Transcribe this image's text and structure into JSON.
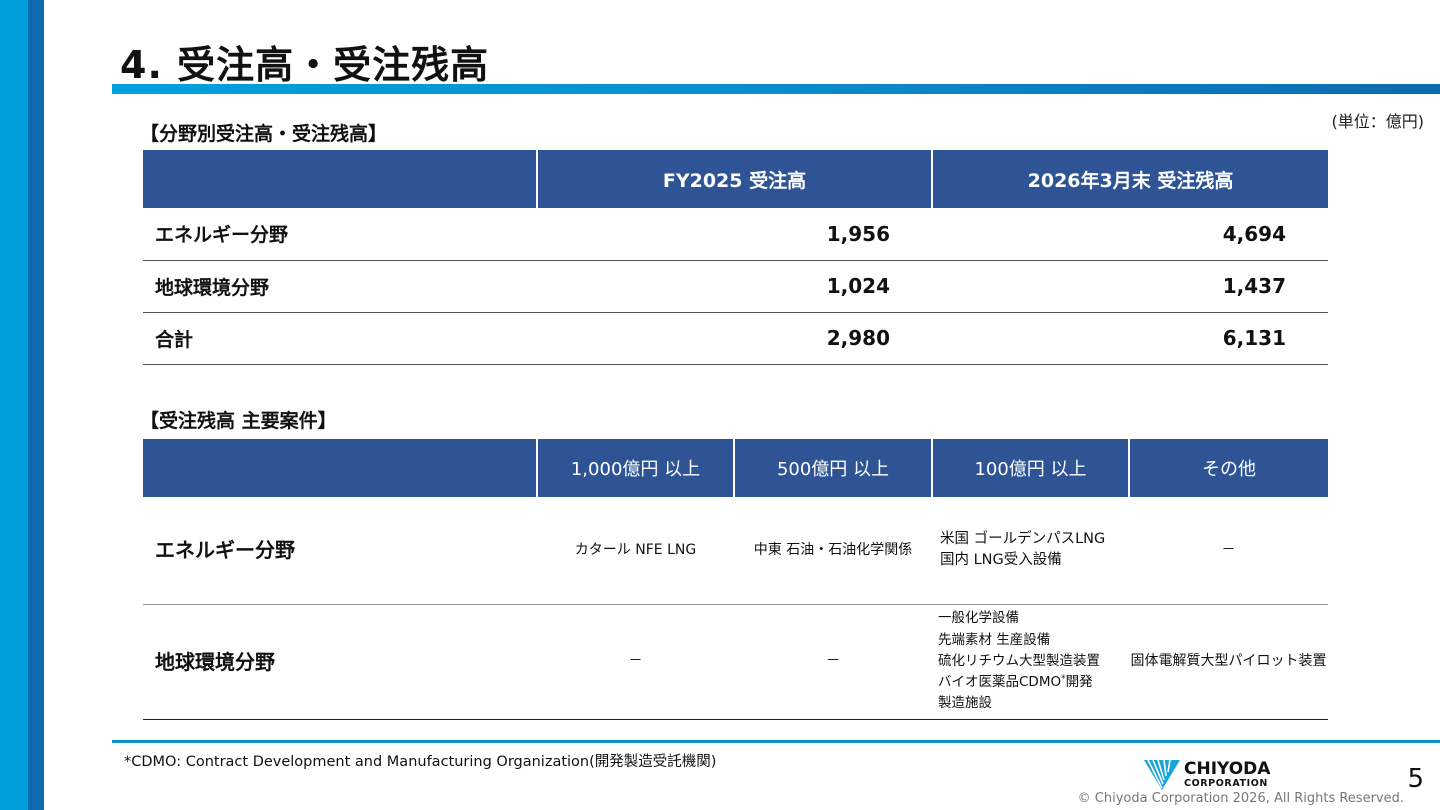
{
  "slide": {
    "title": "4. 受注高・受注残高",
    "unit_note": "(単位：億円)",
    "page_number": "5",
    "copyright": "© Chiyoda Corporation 2026, All Rights Reserved.",
    "footnote": "*CDMO: Contract Development and Manufacturing Organization(開発製造受託機関)"
  },
  "logo": {
    "line1": "CHIYODA",
    "line2": "CORPORATION"
  },
  "colors": {
    "header_blue": "#2e5496",
    "accent_cyan": "#00a0dc",
    "accent_blue": "#0d6bb0"
  },
  "section1": {
    "label": "【分野別受注高・受注残高】",
    "headers": [
      "",
      "FY2025 受注高",
      "2026年3月末 受注残高"
    ],
    "rows": [
      {
        "label": "エネルギー分野",
        "orders": "1,956",
        "backlog": "4,694"
      },
      {
        "label": "地球環境分野",
        "orders": "1,024",
        "backlog": "1,437"
      },
      {
        "label": "合計",
        "orders": "2,980",
        "backlog": "6,131"
      }
    ]
  },
  "section2": {
    "label": "【受注残高 主要案件】",
    "headers": [
      "",
      "1,000億円 以上",
      "500億円 以上",
      "100億円 以上",
      "その他"
    ],
    "rows": [
      {
        "label": "エネルギー分野",
        "c1": "カタール NFE LNG",
        "c2": "中東 石油・石油化学関係",
        "c3": [
          "米国 ゴールデンパスLNG",
          "国内 LNG受入設備"
        ],
        "c4": "－"
      },
      {
        "label": "地球環境分野",
        "c1": "－",
        "c2": "－",
        "c3": [
          "一般化学設備",
          "先端素材 生産設備",
          "硫化リチウム大型製造装置",
          "バイオ医薬品CDMO",
          "開発",
          "製造施設"
        ],
        "c3_sup": "*",
        "c4": "固体電解質大型パイロット装置"
      }
    ]
  }
}
